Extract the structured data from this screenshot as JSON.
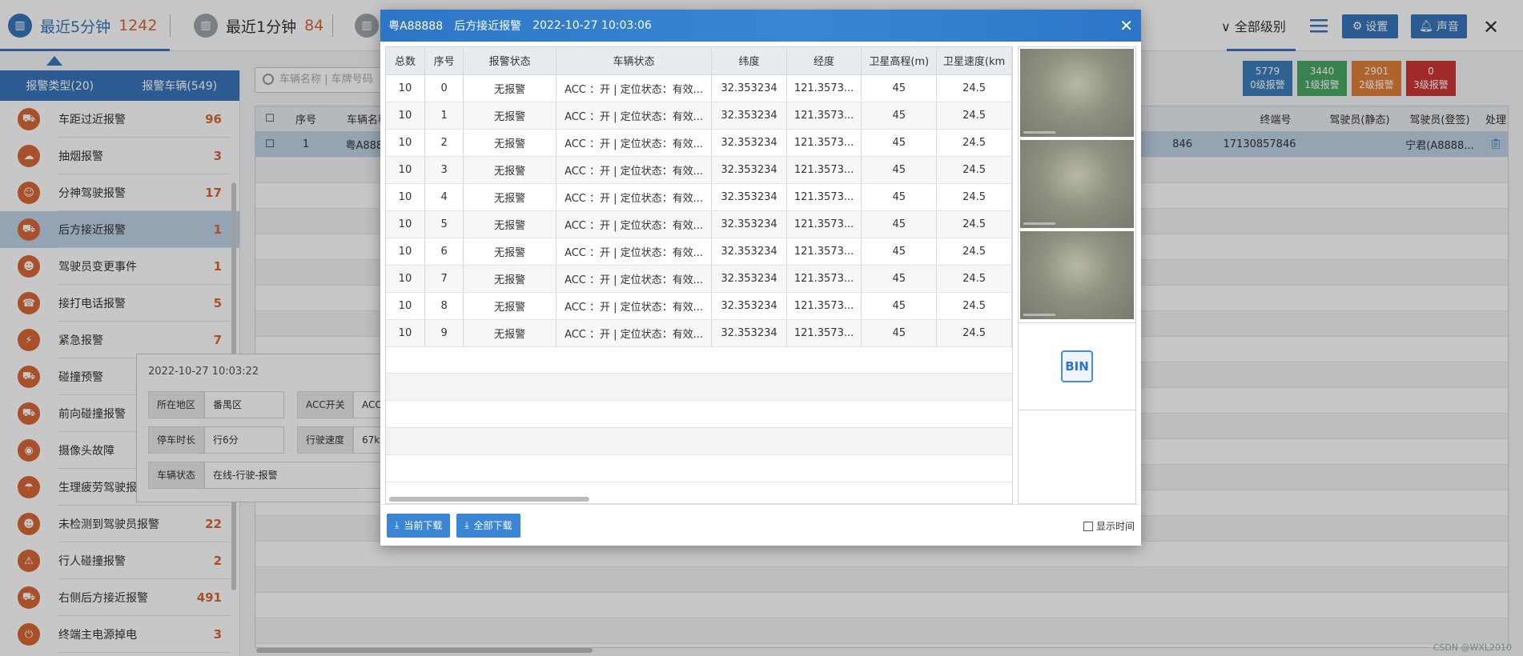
{
  "topbar": {
    "stats": [
      {
        "label": "最近5分钟",
        "count": "1242"
      },
      {
        "label": "最近1分钟",
        "count": "84"
      }
    ],
    "level_select": "全部级别",
    "settings_label": "设置",
    "sound_label": "声音",
    "level_badges": [
      {
        "count": "5779",
        "label": "0级报警",
        "color": "#2f80c8"
      },
      {
        "count": "3440",
        "label": "1级报警",
        "color": "#3faa5f"
      },
      {
        "count": "2901",
        "label": "2级报警",
        "color": "#ef7d2a"
      },
      {
        "count": "0",
        "label": "3级报警",
        "color": "#e23030"
      }
    ]
  },
  "sidebar": {
    "tabs": [
      "报警类型(20)",
      "报警车辆(549)"
    ],
    "items": [
      {
        "name": "车距过近报警",
        "count": "96"
      },
      {
        "name": "抽烟报警",
        "count": "3"
      },
      {
        "name": "分神驾驶报警",
        "count": "17"
      },
      {
        "name": "后方接近报警",
        "count": "1"
      },
      {
        "name": "驾驶员变更事件",
        "count": "1"
      },
      {
        "name": "接打电话报警",
        "count": "5"
      },
      {
        "name": "紧急报警",
        "count": "7"
      },
      {
        "name": "碰撞预警",
        "count": ""
      },
      {
        "name": "前向碰撞报警",
        "count": ""
      },
      {
        "name": "摄像头故障",
        "count": ""
      },
      {
        "name": "生理疲劳驾驶报",
        "count": ""
      },
      {
        "name": "未检测到驾驶员报警",
        "count": "22"
      },
      {
        "name": "行人碰撞报警",
        "count": "2"
      },
      {
        "name": "右侧后方接近报警",
        "count": "491"
      },
      {
        "name": "终端主电源掉电",
        "count": "3"
      }
    ]
  },
  "search": {
    "placeholder": "车辆名称 | 车牌号码"
  },
  "grid": {
    "headers_left": [
      "序号",
      "车辆名称"
    ],
    "headers_right": [
      "终端号",
      "驾驶员(静态)",
      "驾驶员(登签)",
      "处理"
    ],
    "row": {
      "index": "1",
      "name": "粤A8888",
      "sim_tail": "846",
      "terminal": "17130857846",
      "driver_signed": "宁君(A8888..."
    }
  },
  "tooltip": {
    "time": "2022-10-27 10:03:22",
    "region_label": "所在地区",
    "region_value": "番禺区",
    "acc_label": "ACC开关",
    "acc_value": "ACC",
    "park_label": "停车时长",
    "park_value": "行6分",
    "speed_label": "行驶速度",
    "speed_value": "67k",
    "status_label": "车辆状态",
    "status_value": "在线-行驶-报警"
  },
  "dialog": {
    "plate": "粤A88888",
    "alarm_type": "后方接近报警",
    "time": "2022-10-27 10:03:06",
    "columns": [
      "总数",
      "序号",
      "报警状态",
      "车辆状态",
      "纬度",
      "经度",
      "卫星高程(m)",
      "卫星速度(km"
    ],
    "rows": [
      [
        "10",
        "0",
        "无报警",
        "ACC ：开 | 定位状态：有效...",
        "32.353234",
        "121.3573...",
        "45",
        "24.5"
      ],
      [
        "10",
        "1",
        "无报警",
        "ACC ：开 | 定位状态：有效...",
        "32.353234",
        "121.3573...",
        "45",
        "24.5"
      ],
      [
        "10",
        "2",
        "无报警",
        "ACC ：开 | 定位状态：有效...",
        "32.353234",
        "121.3573...",
        "45",
        "24.5"
      ],
      [
        "10",
        "3",
        "无报警",
        "ACC ：开 | 定位状态：有效...",
        "32.353234",
        "121.3573...",
        "45",
        "24.5"
      ],
      [
        "10",
        "4",
        "无报警",
        "ACC ：开 | 定位状态：有效...",
        "32.353234",
        "121.3573...",
        "45",
        "24.5"
      ],
      [
        "10",
        "5",
        "无报警",
        "ACC ：开 | 定位状态：有效...",
        "32.353234",
        "121.3573...",
        "45",
        "24.5"
      ],
      [
        "10",
        "6",
        "无报警",
        "ACC ：开 | 定位状态：有效...",
        "32.353234",
        "121.3573...",
        "45",
        "24.5"
      ],
      [
        "10",
        "7",
        "无报警",
        "ACC ：开 | 定位状态：有效...",
        "32.353234",
        "121.3573...",
        "45",
        "24.5"
      ],
      [
        "10",
        "8",
        "无报警",
        "ACC ：开 | 定位状态：有效...",
        "32.353234",
        "121.3573...",
        "45",
        "24.5"
      ],
      [
        "10",
        "9",
        "无报警",
        "ACC ：开 | 定位状态：有效...",
        "32.353234",
        "121.3573...",
        "45",
        "24.5"
      ]
    ],
    "bin_label": "BIN",
    "download_current": "当前下载",
    "download_all": "全部下载",
    "show_time": "显示时间"
  },
  "watermark": "CSDN @WXL2010"
}
